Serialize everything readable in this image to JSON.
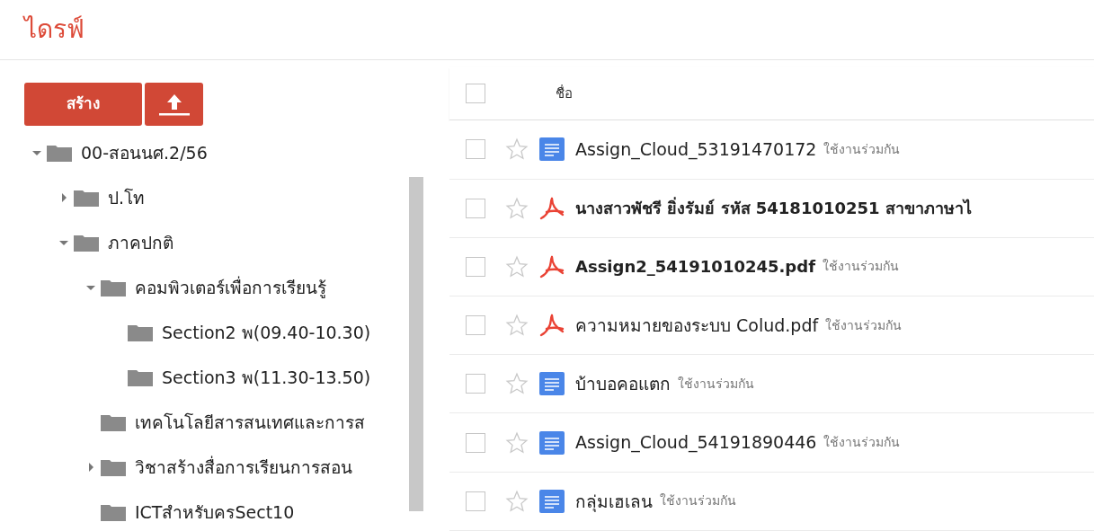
{
  "title": "ไดรฟ์",
  "create_button": "สร้าง",
  "tree": [
    {
      "label": "00-สอนนศ.2/56",
      "expanded": true,
      "children": [
        {
          "label": "ป.โท",
          "expanded": false
        },
        {
          "label": "ภาคปกติ",
          "expanded": true,
          "children": [
            {
              "label": "คอมพิวเตอร์เพื่อการเรียนรู้",
              "expanded": true,
              "children": [
                {
                  "label": "Section2 พ(09.40-10.30)"
                },
                {
                  "label": "Section3 พ(11.30-13.50)"
                }
              ]
            },
            {
              "label": "เทคโนโลยีสารสนเทศและการส"
            },
            {
              "label": "วิชาสร้างสื่อการเรียนการสอน",
              "expanded": false
            },
            {
              "label": "ICTสำหรับครSect10"
            }
          ]
        }
      ]
    }
  ],
  "table": {
    "columns": [
      "ชื่อ"
    ],
    "all_checked": false,
    "rows": [
      {
        "kind": "doc",
        "name": "Assign_Cloud_53191470172",
        "bold": false,
        "shared": "ใช้งานร่วมกัน",
        "checked": false,
        "starred": false
      },
      {
        "kind": "pdf",
        "name": "นางสาวพัชรี ยิ่งรัมย์ รหัส 54181010251 สาขาภาษาไ",
        "bold": true,
        "checked": false,
        "starred": false
      },
      {
        "kind": "pdf",
        "name": "Assign2_54191010245.pdf",
        "bold": true,
        "shared": "ใช้งานร่วมกัน",
        "checked": false,
        "starred": false
      },
      {
        "kind": "pdf",
        "name": "ความหมายของระบบ Colud.pdf",
        "bold": false,
        "shared": "ใช้งานร่วมกัน",
        "checked": false,
        "starred": false
      },
      {
        "kind": "doc",
        "name": "บ้าบอคอแตก",
        "bold": false,
        "shared": "ใช้งานร่วมกัน",
        "checked": false,
        "starred": false
      },
      {
        "kind": "doc",
        "name": "Assign_Cloud_54191890446",
        "bold": false,
        "shared": "ใช้งานร่วมกัน",
        "checked": false,
        "starred": false
      },
      {
        "kind": "doc",
        "name": "กลุ่มเฮเลน",
        "bold": false,
        "shared": "ใช้งานร่วมกัน",
        "checked": false,
        "starred": false
      }
    ]
  }
}
